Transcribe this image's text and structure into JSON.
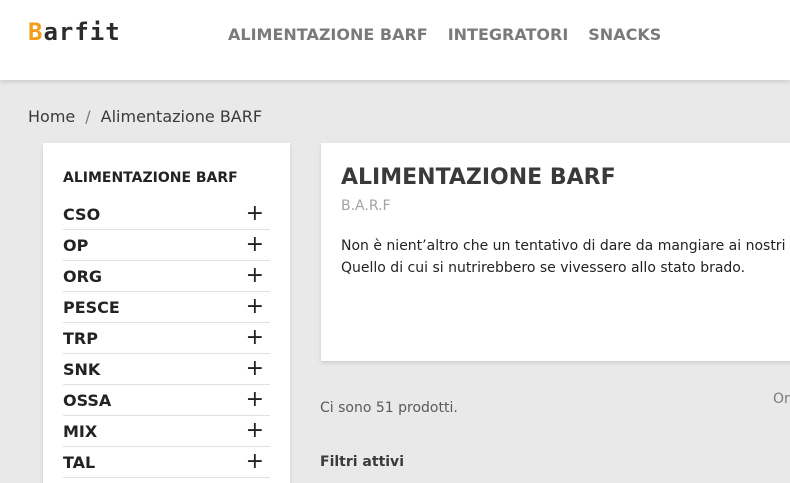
{
  "header": {
    "logo_first": "B",
    "logo_rest": "arfit",
    "nav": [
      "ALIMENTAZIONE BARF",
      "INTEGRATORI",
      "SNACKS"
    ]
  },
  "breadcrumb": {
    "home": "Home",
    "separator": "/",
    "current": "Alimentazione BARF"
  },
  "sidebar": {
    "title": "ALIMENTAZIONE BARF",
    "expand_icon": "plus-icon",
    "items": [
      "CSO",
      "OP",
      "ORG",
      "PESCE",
      "TRP",
      "SNK",
      "OSSA",
      "MIX",
      "TAL"
    ]
  },
  "category": {
    "title": "ALIMENTAZIONE BARF",
    "subtitle": "B.A.R.F",
    "desc_line1": "Non è nient’altro che un tentativo di dare da mangiare ai nostri",
    "desc_line2": "Quello di cui si nutrirebbero se vivessero allo stato brado."
  },
  "listing": {
    "count_text": "Ci sono 51 prodotti.",
    "order_label": "Or",
    "filters_title": "Filtri attivi"
  },
  "colors": {
    "accent": "#f39d1a",
    "page_bg": "#e9e9e9"
  }
}
